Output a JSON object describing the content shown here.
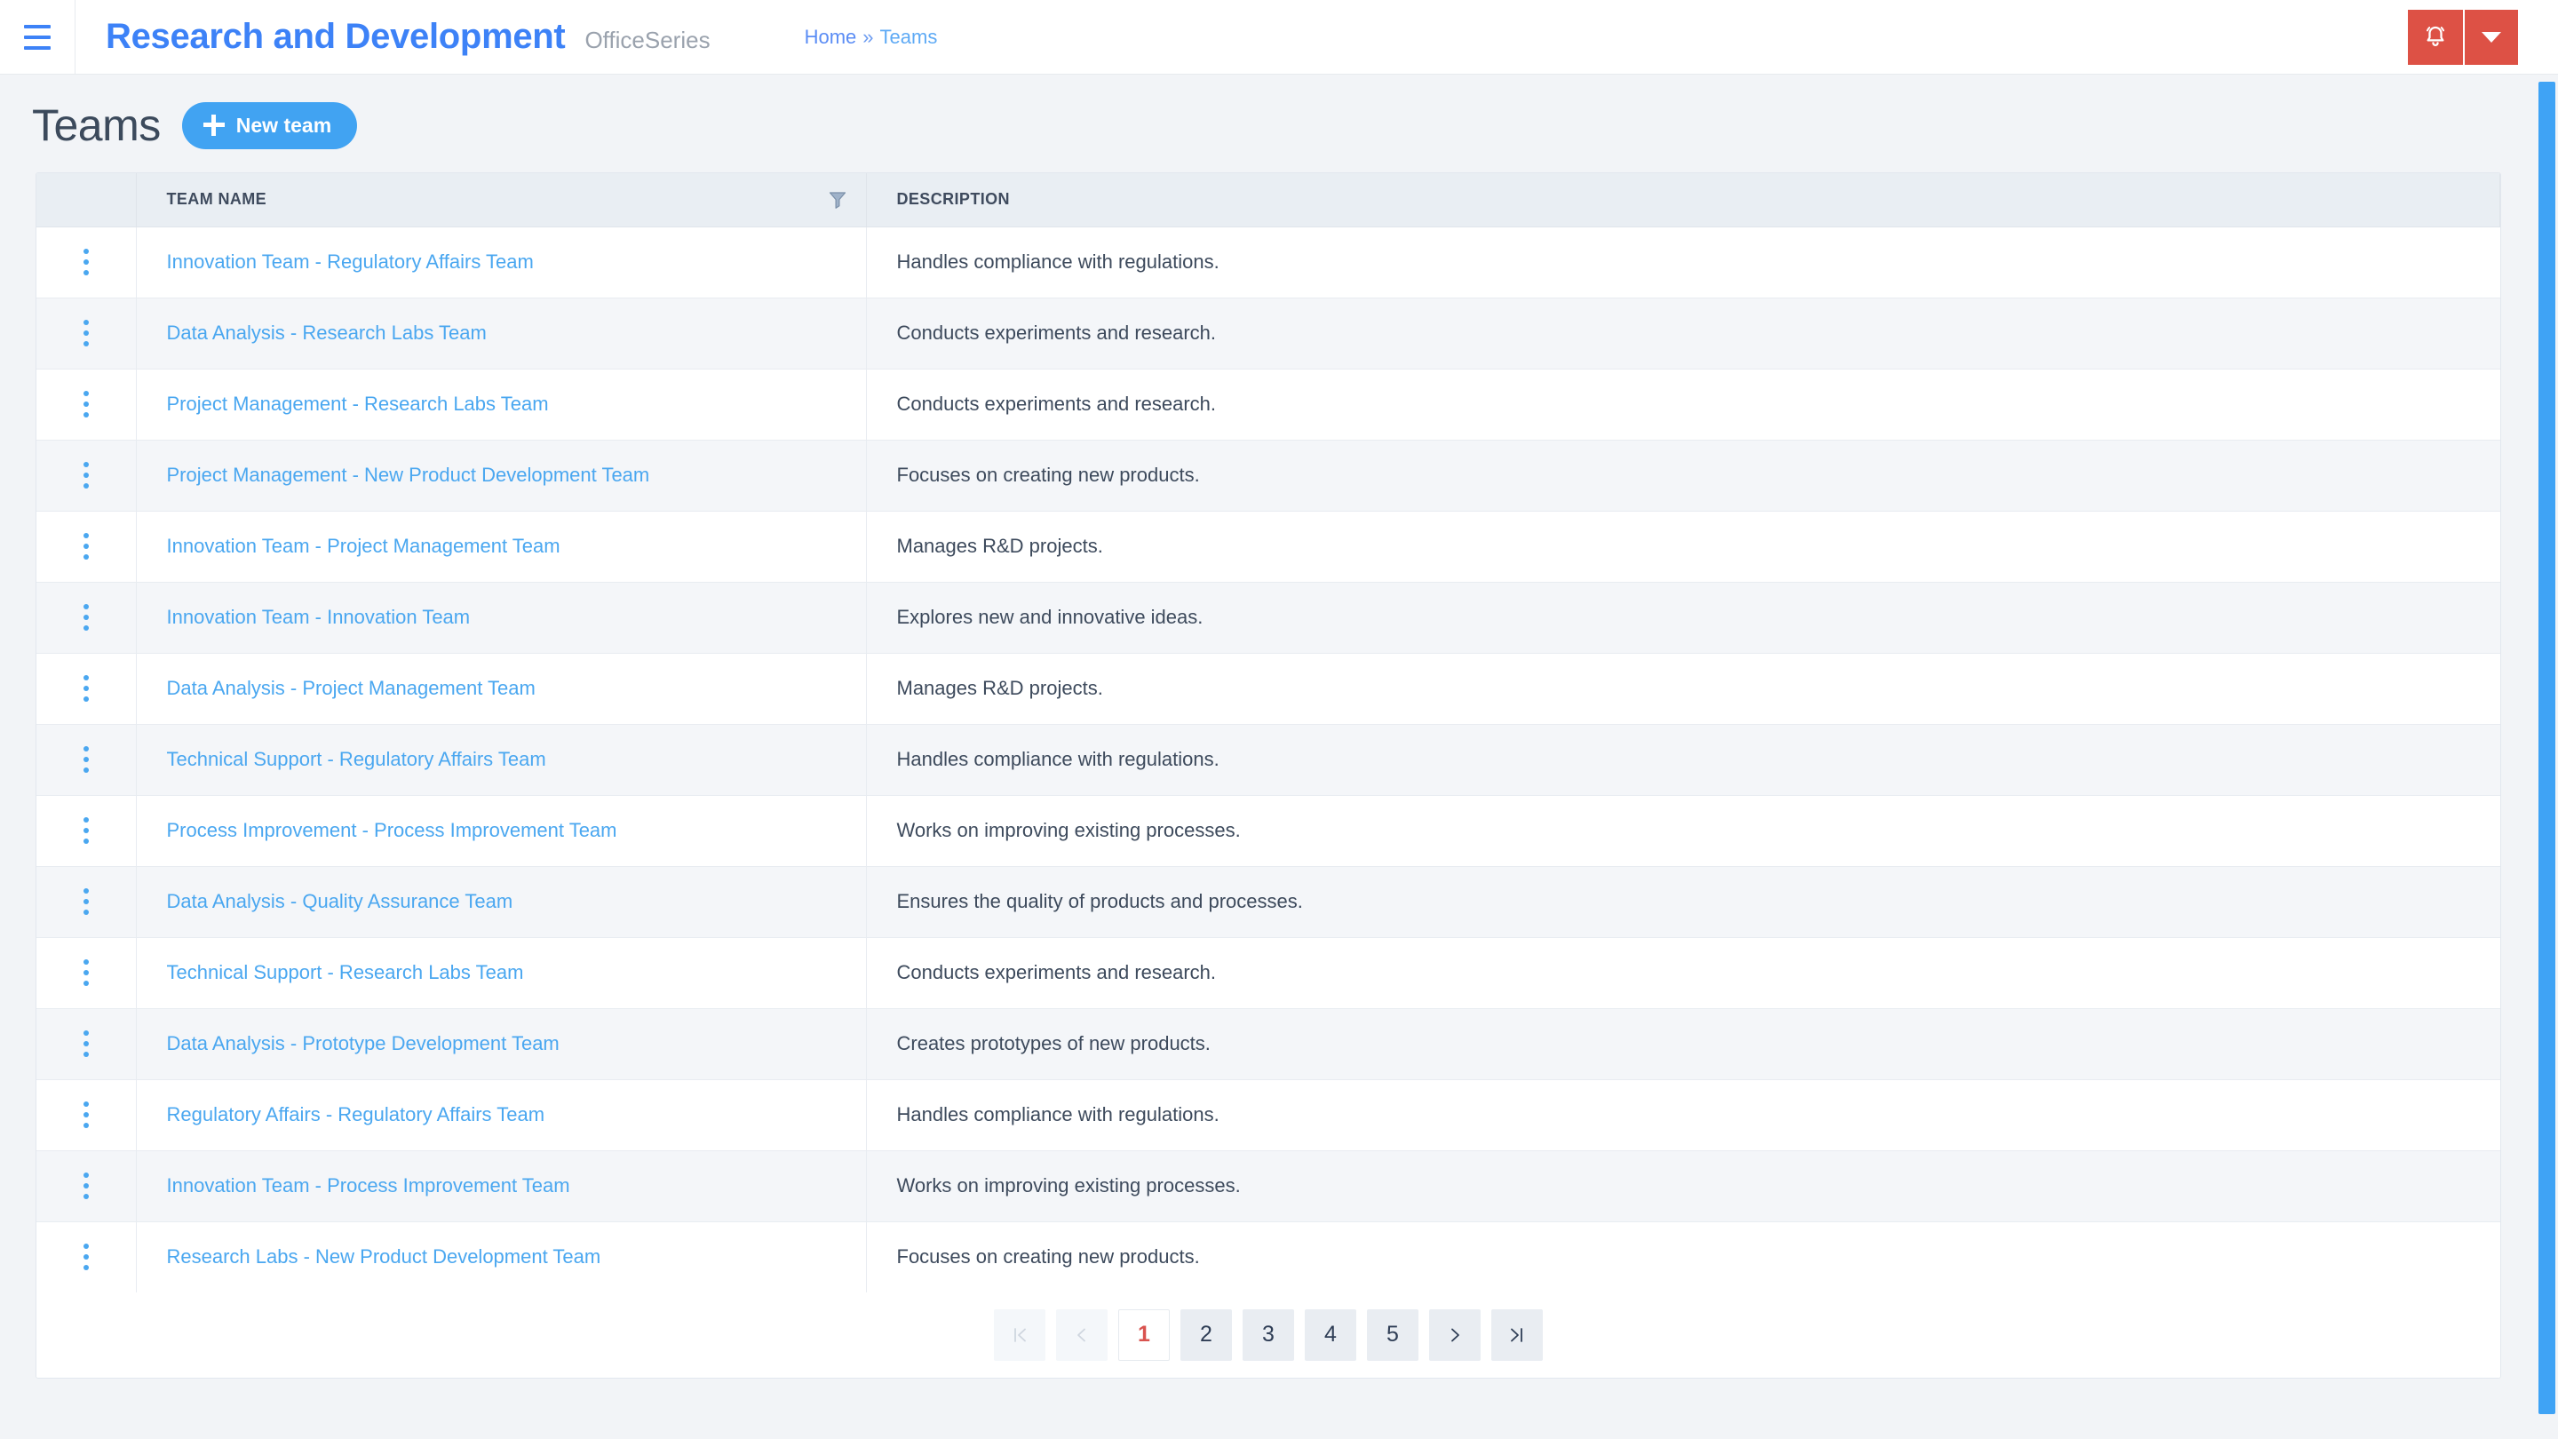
{
  "topbar": {
    "menu_icon": "hamburger-icon",
    "brand_title": "Research and Development",
    "brand_subtitle": "OfficeSeries",
    "breadcrumb": {
      "home": "Home",
      "separator": "»",
      "current": "Teams"
    },
    "notification_icon": "bell-icon",
    "dropdown_icon": "caret-down-icon",
    "accent_red": "#dd5145",
    "accent_blue": "#3d82f7"
  },
  "page": {
    "title": "Teams",
    "new_team_label": "New team",
    "new_team_icon": "plus-icon",
    "button_color": "#41a3f2"
  },
  "table": {
    "columns": [
      "",
      "TEAM NAME",
      "DESCRIPTION"
    ],
    "filter_icon": "filter-funnel-icon",
    "row_menu_icon": "kebab-menu-icon",
    "link_color": "#4aa7f0",
    "rows": [
      {
        "name": "Innovation Team - Regulatory Affairs Team",
        "description": "Handles compliance with regulations."
      },
      {
        "name": "Data Analysis - Research Labs Team",
        "description": "Conducts experiments and research."
      },
      {
        "name": "Project Management - Research Labs Team",
        "description": "Conducts experiments and research."
      },
      {
        "name": "Project Management - New Product Development Team",
        "description": "Focuses on creating new products."
      },
      {
        "name": "Innovation Team - Project Management Team",
        "description": "Manages R&D projects."
      },
      {
        "name": "Innovation Team - Innovation Team",
        "description": "Explores new and innovative ideas."
      },
      {
        "name": "Data Analysis - Project Management Team",
        "description": "Manages R&D projects."
      },
      {
        "name": "Technical Support - Regulatory Affairs Team",
        "description": "Handles compliance with regulations."
      },
      {
        "name": "Process Improvement - Process Improvement Team",
        "description": "Works on improving existing processes."
      },
      {
        "name": "Data Analysis - Quality Assurance Team",
        "description": "Ensures the quality of products and processes."
      },
      {
        "name": "Technical Support - Research Labs Team",
        "description": "Conducts experiments and research."
      },
      {
        "name": "Data Analysis - Prototype Development Team",
        "description": "Creates prototypes of new products."
      },
      {
        "name": "Regulatory Affairs - Regulatory Affairs Team",
        "description": "Handles compliance with regulations."
      },
      {
        "name": "Innovation Team - Process Improvement Team",
        "description": "Works on improving existing processes."
      },
      {
        "name": "Research Labs - New Product Development Team",
        "description": "Focuses on creating new products."
      }
    ]
  },
  "pagination": {
    "first_label": "|<",
    "prev_label": "<",
    "next_label": ">",
    "last_label": ">|",
    "pages": [
      "1",
      "2",
      "3",
      "4",
      "5"
    ],
    "active_page": "1",
    "active_color": "#d9534f"
  },
  "scrollbar": {
    "thumb_color": "#3fa3f5"
  }
}
